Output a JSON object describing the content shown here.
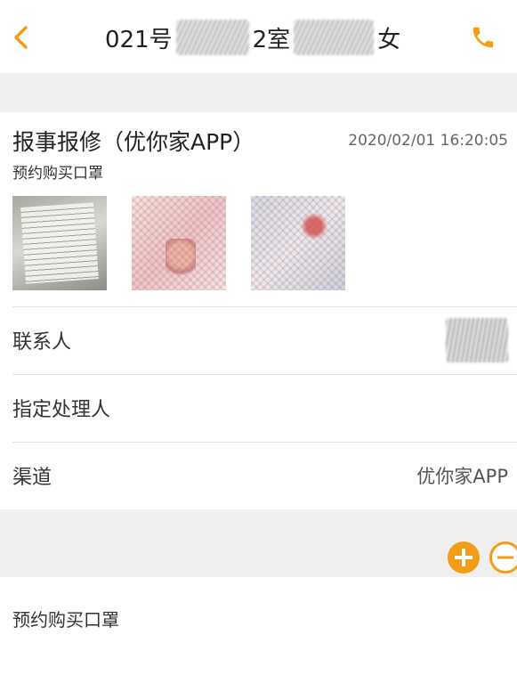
{
  "header": {
    "title_prefix": "021号",
    "title_mid": "2室",
    "title_suffix": "女",
    "back_icon": "chevron-left-icon",
    "call_icon": "phone-icon",
    "accent_color": "#f39c16"
  },
  "report": {
    "title": "报事报修（优你家APP）",
    "time": "2020/02/01 16:20:05",
    "description": "预约购买口罩",
    "photos": [
      "document-photo",
      "id-card-front-photo",
      "id-card-back-photo"
    ]
  },
  "fields": {
    "contact_label": "联系人",
    "handler_label": "指定处理人",
    "channel_label": "渠道",
    "channel_value": "优你家APP"
  },
  "actions": {
    "add_icon": "plus-circle-icon",
    "remove_icon": "minus-circle-icon"
  },
  "note": {
    "text": "预约购买口罩"
  }
}
